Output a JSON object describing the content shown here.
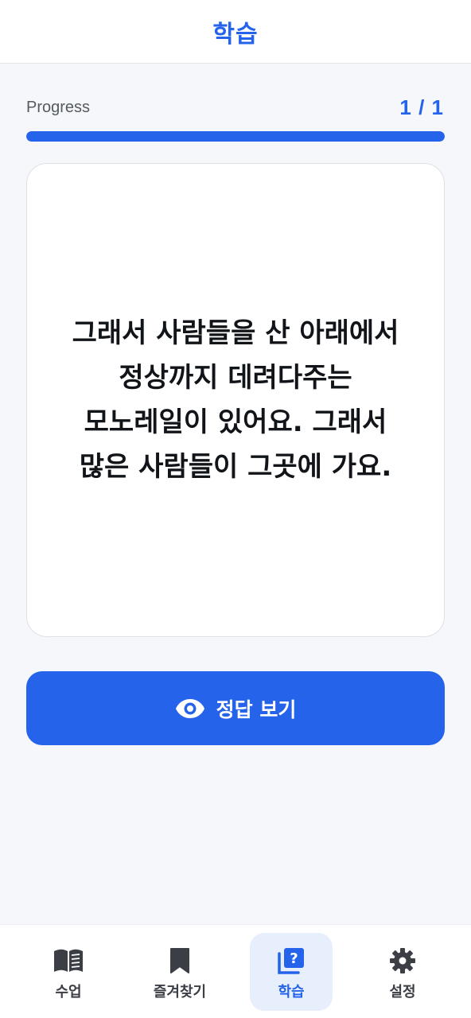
{
  "header": {
    "title": "학습"
  },
  "progress": {
    "label": "Progress",
    "count": "1 / 1",
    "fraction": 1.0
  },
  "card": {
    "text": "그래서 사람들을 산 아래에서\n정상까지 데려다주는\n모노레일이 있어요. 그래서\n많은 사람들이 그곳에 가요."
  },
  "answer_button": {
    "label": "정답 보기",
    "icon": "eye-icon"
  },
  "nav": {
    "items": [
      {
        "label": "수업",
        "icon": "book-icon",
        "active": false
      },
      {
        "label": "즐겨찾기",
        "icon": "bookmark-icon",
        "active": false
      },
      {
        "label": "학습",
        "icon": "quiz-icon",
        "active": true
      },
      {
        "label": "설정",
        "icon": "gear-icon",
        "active": false
      }
    ]
  },
  "colors": {
    "accent": "#2563eb",
    "background": "#f5f7fa",
    "active_tab_bg": "#e7eefc",
    "text_dark": "#111418"
  }
}
